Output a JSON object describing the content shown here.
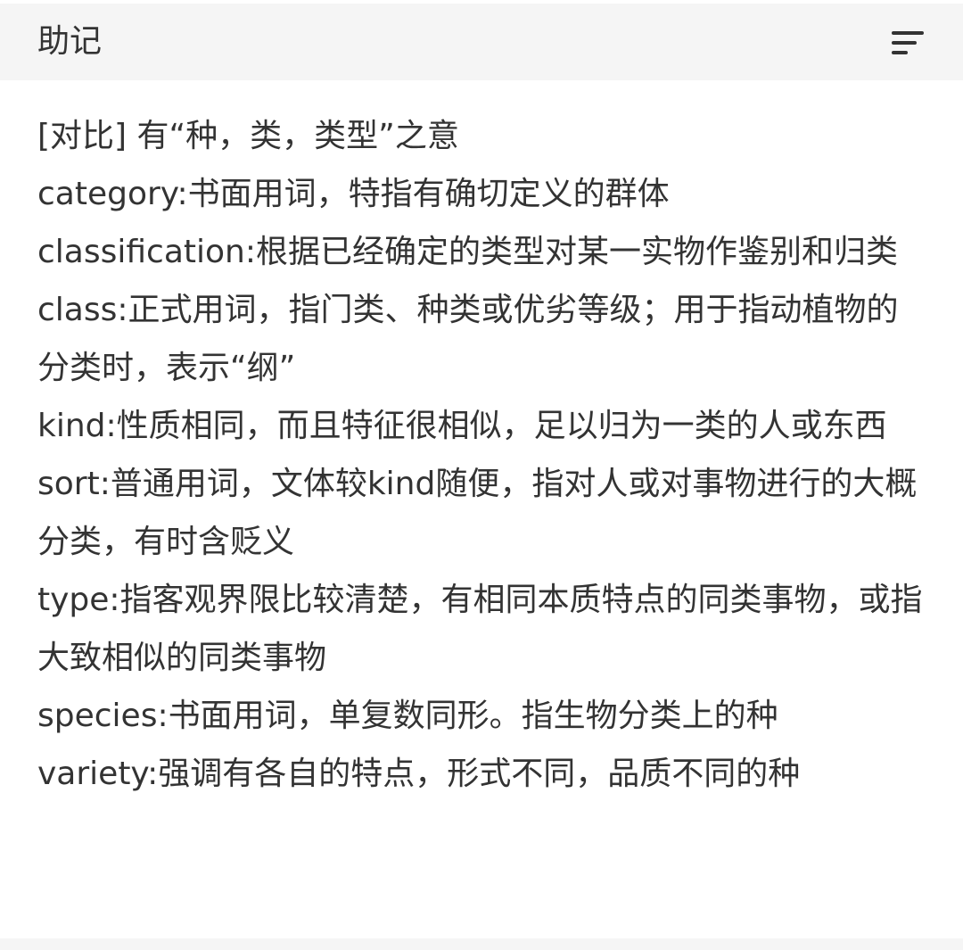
{
  "header": {
    "title": "助记",
    "sort_icon": "sort-icon"
  },
  "content": {
    "lines": [
      "[对比] 有“种，类，类型”之意",
      "category:书面用词，特指有确切定义的群体",
      "classification:根据已经确定的类型对某一实物作鉴别和归类",
      "class:正式用词，指门类、种类或优劣等级；用于指动植物的分类时，表示“纲”",
      "kind:性质相同，而且特征很相似，足以归为一类的人或东西",
      "sort:普通用词，文体较kind随便，指对人或对事物进行的大概分类，有时含贬义",
      "type:指客观界限比较清楚，有相同本质特点的同类事物，或指大致相似的同类事物",
      "species:书面用词，单复数同形。指生物分类上的种",
      "variety:强调有各自的特点，形式不同，品质不同的种"
    ]
  },
  "colors": {
    "text": "#333333",
    "header_bg": "#f5f5f5",
    "icon": "#333333"
  }
}
